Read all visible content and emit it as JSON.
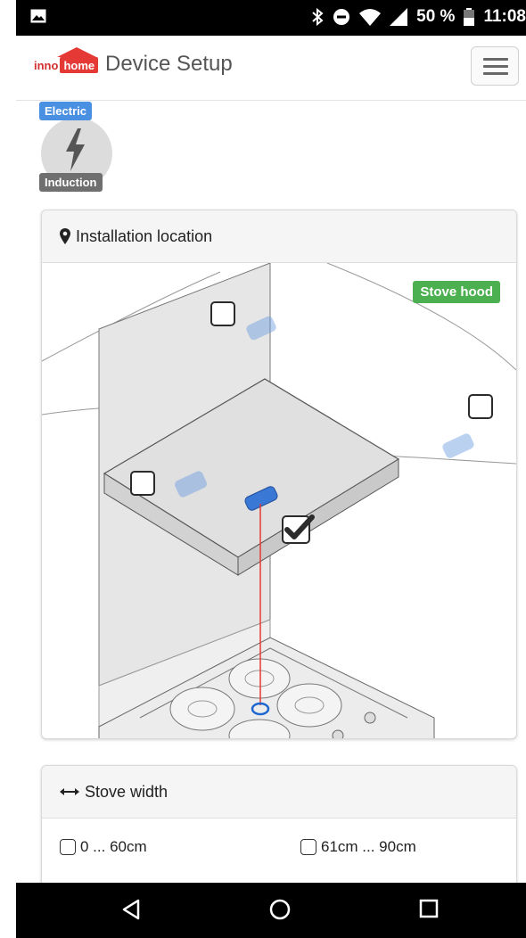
{
  "status_bar": {
    "battery_percent": "50 %",
    "time": "11:08",
    "icons": [
      "image-icon",
      "bluetooth-icon",
      "do-not-disturb-icon",
      "wifi-icon",
      "signal-icon",
      "battery-icon"
    ]
  },
  "header": {
    "logo_inno": "inno",
    "logo_home": "home",
    "title": "Device Setup",
    "menu_icon": "hamburger-menu-icon"
  },
  "device": {
    "top_tag": "Electric",
    "bottom_tag": "Induction",
    "icon": "lightning-bolt-icon"
  },
  "installation": {
    "heading": "Installation location",
    "icon": "map-marker-icon",
    "stove_hood_label": "Stove hood",
    "positions": [
      {
        "name": "wall-top",
        "checked": false
      },
      {
        "name": "right-wall",
        "checked": false
      },
      {
        "name": "hood-left",
        "checked": false
      },
      {
        "name": "hood-center",
        "checked": true
      }
    ]
  },
  "stove_width": {
    "heading": "Stove width",
    "icon": "arrows-horizontal-icon",
    "options": [
      {
        "label": "0 ... 60cm",
        "checked": false
      },
      {
        "label": "61cm ... 90cm",
        "checked": false
      }
    ]
  },
  "navigation": {
    "icons": [
      "back-icon",
      "home-icon",
      "recents-icon"
    ]
  },
  "colors": {
    "brand_red": "#e53935",
    "electric_tag": "#4a90e2",
    "induction_tag": "#6f6f6f",
    "stove_hood_badge": "#4caf50",
    "laser_line": "#e53935"
  }
}
